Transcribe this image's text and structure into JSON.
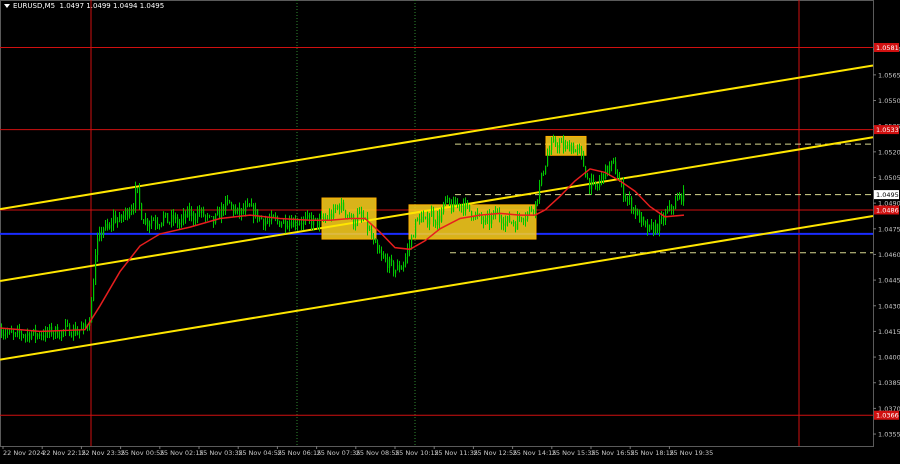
{
  "header": {
    "symbol_timeframe": "EURUSD,M5",
    "ohlc": "1.0497 1.0499 1.0494 1.0495"
  },
  "colors": {
    "background": "#000000",
    "candle": "#00c800",
    "ma": "#e61e1e",
    "channel": "#ffe600",
    "support_resistance": "#d01010",
    "blue_level": "#1a2cff",
    "zone_fill": "#ffd21e",
    "dashed_level": "#d8d890",
    "current_price_label": "#ffffff",
    "grid_dotted": "#2f8a2f",
    "axis_text": "#c8c8c8"
  },
  "chart_data": {
    "type": "candlestick",
    "symbol": "EURUSD",
    "timeframe": "M5",
    "ylim": [
      1.035,
      1.06
    ],
    "y_ticks": [
      "1.0355",
      "1.0370",
      "1.0385",
      "1.0400",
      "1.0415",
      "1.0430",
      "1.0445",
      "1.0460",
      "1.0475",
      "1.0490",
      "1.0505",
      "1.0520",
      "1.0535",
      "1.0550",
      "1.0565",
      "1.0580"
    ],
    "x_ticks": [
      "22 Nov 2024",
      "22 Nov 22:15",
      "22 Nov 23:35",
      "25 Nov 00:55",
      "25 Nov 02:15",
      "25 Nov 03:35",
      "25 Nov 04:55",
      "25 Nov 06:15",
      "25 Nov 07:35",
      "25 Nov 08:55",
      "25 Nov 10:15",
      "25 Nov 11:35",
      "25 Nov 12:55",
      "25 Nov 14:15",
      "25 Nov 15:35",
      "25 Nov 16:55",
      "25 Nov 18:15",
      "25 Nov 19:35"
    ],
    "price_path": [
      [
        0,
        1.0416
      ],
      [
        5,
        1.0415
      ],
      [
        10,
        1.0413
      ],
      [
        15,
        1.0412
      ],
      [
        20,
        1.0414
      ],
      [
        25,
        1.0413
      ],
      [
        30,
        1.0414
      ],
      [
        35,
        1.0413
      ],
      [
        40,
        1.0414
      ],
      [
        45,
        1.0413
      ],
      [
        50,
        1.0415
      ],
      [
        55,
        1.0415
      ],
      [
        60,
        1.0414
      ],
      [
        65,
        1.0416
      ],
      [
        70,
        1.0416
      ],
      [
        75,
        1.0415
      ],
      [
        80,
        1.0416
      ],
      [
        85,
        1.0417
      ],
      [
        90,
        1.0425
      ],
      [
        93,
        1.0445
      ],
      [
        96,
        1.0465
      ],
      [
        99,
        1.047
      ],
      [
        103,
        1.0476
      ],
      [
        108,
        1.0474
      ],
      [
        113,
        1.0482
      ],
      [
        118,
        1.0479
      ],
      [
        123,
        1.0483
      ],
      [
        128,
        1.0486
      ],
      [
        133,
        1.049
      ],
      [
        136,
        1.0499
      ],
      [
        139,
        1.0489
      ],
      [
        142,
        1.0481
      ],
      [
        147,
        1.0479
      ],
      [
        152,
        1.0481
      ],
      [
        158,
        1.0479
      ],
      [
        163,
        1.0482
      ],
      [
        168,
        1.0479
      ],
      [
        173,
        1.0481
      ],
      [
        178,
        1.0478
      ],
      [
        183,
        1.0481
      ],
      [
        188,
        1.0484
      ],
      [
        193,
        1.0482
      ],
      [
        198,
        1.0485
      ],
      [
        203,
        1.0483
      ],
      [
        208,
        1.048
      ],
      [
        213,
        1.0479
      ],
      [
        218,
        1.0483
      ],
      [
        223,
        1.0488
      ],
      [
        228,
        1.049
      ],
      [
        233,
        1.0486
      ],
      [
        238,
        1.0484
      ],
      [
        243,
        1.0485
      ],
      [
        248,
        1.0487
      ],
      [
        253,
        1.0485
      ],
      [
        258,
        1.0482
      ],
      [
        263,
        1.048
      ],
      [
        268,
        1.0479
      ],
      [
        273,
        1.048
      ],
      [
        278,
        1.0479
      ],
      [
        283,
        1.0479
      ],
      [
        288,
        1.048
      ],
      [
        293,
        1.0479
      ],
      [
        298,
        1.048
      ],
      [
        303,
        1.0479
      ],
      [
        308,
        1.048
      ],
      [
        313,
        1.0479
      ],
      [
        318,
        1.0479
      ],
      [
        323,
        1.048
      ],
      [
        328,
        1.0482
      ],
      [
        333,
        1.0484
      ],
      [
        338,
        1.0489
      ],
      [
        343,
        1.0487
      ],
      [
        348,
        1.0483
      ],
      [
        353,
        1.0479
      ],
      [
        358,
        1.0483
      ],
      [
        363,
        1.048
      ],
      [
        368,
        1.0475
      ],
      [
        373,
        1.0466
      ],
      [
        378,
        1.046
      ],
      [
        383,
        1.0457
      ],
      [
        388,
        1.0455
      ],
      [
        393,
        1.0451
      ],
      [
        398,
        1.0452
      ],
      [
        403,
        1.0455
      ],
      [
        407,
        1.0462
      ],
      [
        411,
        1.0469
      ],
      [
        415,
        1.0478
      ],
      [
        420,
        1.0482
      ],
      [
        425,
        1.0478
      ],
      [
        430,
        1.0485
      ],
      [
        435,
        1.048
      ],
      [
        440,
        1.0482
      ],
      [
        445,
        1.0491
      ],
      [
        450,
        1.0487
      ],
      [
        455,
        1.0489
      ],
      [
        460,
        1.049
      ],
      [
        465,
        1.0488
      ],
      [
        470,
        1.0485
      ],
      [
        475,
        1.0483
      ],
      [
        480,
        1.048
      ],
      [
        485,
        1.0479
      ],
      [
        490,
        1.048
      ],
      [
        495,
        1.0484
      ],
      [
        500,
        1.0482
      ],
      [
        505,
        1.0479
      ],
      [
        510,
        1.048
      ],
      [
        515,
        1.0478
      ],
      [
        520,
        1.0483
      ],
      [
        525,
        1.0483
      ],
      [
        530,
        1.0486
      ],
      [
        535,
        1.049
      ],
      [
        540,
        1.0502
      ],
      [
        544,
        1.0512
      ],
      [
        548,
        1.052
      ],
      [
        552,
        1.0524
      ],
      [
        556,
        1.0525
      ],
      [
        560,
        1.0524
      ],
      [
        565,
        1.0522
      ],
      [
        570,
        1.0524
      ],
      [
        575,
        1.0521
      ],
      [
        580,
        1.0519
      ],
      [
        584,
        1.051
      ],
      [
        588,
        1.0502
      ],
      [
        592,
        1.05
      ],
      [
        596,
        1.0498
      ],
      [
        600,
        1.0505
      ],
      [
        604,
        1.0508
      ],
      [
        608,
        1.051
      ],
      [
        612,
        1.0513
      ],
      [
        616,
        1.0508
      ],
      [
        620,
        1.05
      ],
      [
        625,
        1.0494
      ],
      [
        630,
        1.049
      ],
      [
        635,
        1.0485
      ],
      [
        640,
        1.048
      ],
      [
        645,
        1.0475
      ],
      [
        650,
        1.0474
      ],
      [
        655,
        1.0476
      ],
      [
        660,
        1.0478
      ],
      [
        665,
        1.0483
      ],
      [
        670,
        1.0487
      ],
      [
        675,
        1.049
      ],
      [
        680,
        1.0494
      ],
      [
        684,
        1.0495
      ]
    ],
    "ma_path": [
      [
        0,
        1.0417
      ],
      [
        40,
        1.0415
      ],
      [
        85,
        1.0416
      ],
      [
        100,
        1.043
      ],
      [
        120,
        1.045
      ],
      [
        140,
        1.0465
      ],
      [
        160,
        1.0472
      ],
      [
        190,
        1.0476
      ],
      [
        220,
        1.0481
      ],
      [
        250,
        1.0483
      ],
      [
        280,
        1.0481
      ],
      [
        310,
        1.048
      ],
      [
        330,
        1.048
      ],
      [
        350,
        1.0481
      ],
      [
        365,
        1.0481
      ],
      [
        380,
        1.0473
      ],
      [
        395,
        1.0464
      ],
      [
        410,
        1.0463
      ],
      [
        425,
        1.0468
      ],
      [
        440,
        1.0475
      ],
      [
        460,
        1.0481
      ],
      [
        480,
        1.0483
      ],
      [
        500,
        1.0484
      ],
      [
        520,
        1.0483
      ],
      [
        535,
        1.0483
      ],
      [
        545,
        1.0486
      ],
      [
        560,
        1.0494
      ],
      [
        575,
        1.0503
      ],
      [
        590,
        1.051
      ],
      [
        605,
        1.0508
      ],
      [
        620,
        1.0503
      ],
      [
        635,
        1.0497
      ],
      [
        650,
        1.0488
      ],
      [
        665,
        1.0482
      ],
      [
        684,
        1.0483
      ]
    ],
    "channel_lines": [
      {
        "x": [
          0,
          873
        ],
        "y": [
          1.04865,
          1.05705
        ]
      },
      {
        "x": [
          0,
          873
        ],
        "y": [
          1.04445,
          1.05285
        ]
      },
      {
        "x": [
          0,
          873
        ],
        "y": [
          1.03985,
          1.04825
        ]
      }
    ],
    "horizontal_levels": [
      {
        "name": "resistance-top",
        "price": 1.0581,
        "label": "1.0581",
        "color": "#d01010",
        "style": "solid"
      },
      {
        "name": "resistance-mid",
        "price": 1.0533,
        "label": "1.0533",
        "color": "#d01010",
        "style": "solid"
      },
      {
        "name": "resistance-low",
        "price": 1.0486,
        "label": "1.0486",
        "color": "#d01010",
        "style": "solid"
      },
      {
        "name": "support-bottom",
        "price": 1.0366,
        "label": "1.0366",
        "color": "#d01010",
        "style": "solid"
      },
      {
        "name": "kijun-level",
        "price": 1.0472,
        "label": "",
        "color": "#1a2cff",
        "style": "solid"
      },
      {
        "name": "dashed-upper",
        "price": 1.05245,
        "label": "",
        "color": "#d8d890",
        "style": "dashed",
        "from": 455
      },
      {
        "name": "dashed-middle",
        "price": 1.0495,
        "label": "",
        "color": "#d8d890",
        "style": "dashed",
        "from": 455
      },
      {
        "name": "dashed-lower",
        "price": 1.0461,
        "label": "",
        "color": "#d8d890",
        "style": "dashed",
        "from": 450
      }
    ],
    "current_price": {
      "price": 1.0495,
      "label": "1.0495"
    },
    "rectangles": [
      {
        "x": [
          322,
          376
        ],
        "y": [
          1.0469,
          1.0493
        ]
      },
      {
        "x": [
          409,
          536
        ],
        "y": [
          1.0469,
          1.0489
        ]
      },
      {
        "x": [
          546,
          586
        ],
        "y": [
          1.0518,
          1.0529
        ]
      }
    ],
    "vertical_lines": [
      {
        "x": 91,
        "color": "#d01010",
        "style": "solid"
      },
      {
        "x": 799,
        "color": "#d01010",
        "style": "solid"
      },
      {
        "x": 297,
        "color": "#2f8a2f",
        "style": "dotted"
      },
      {
        "x": 415,
        "color": "#2f8a2f",
        "style": "dotted"
      }
    ]
  }
}
